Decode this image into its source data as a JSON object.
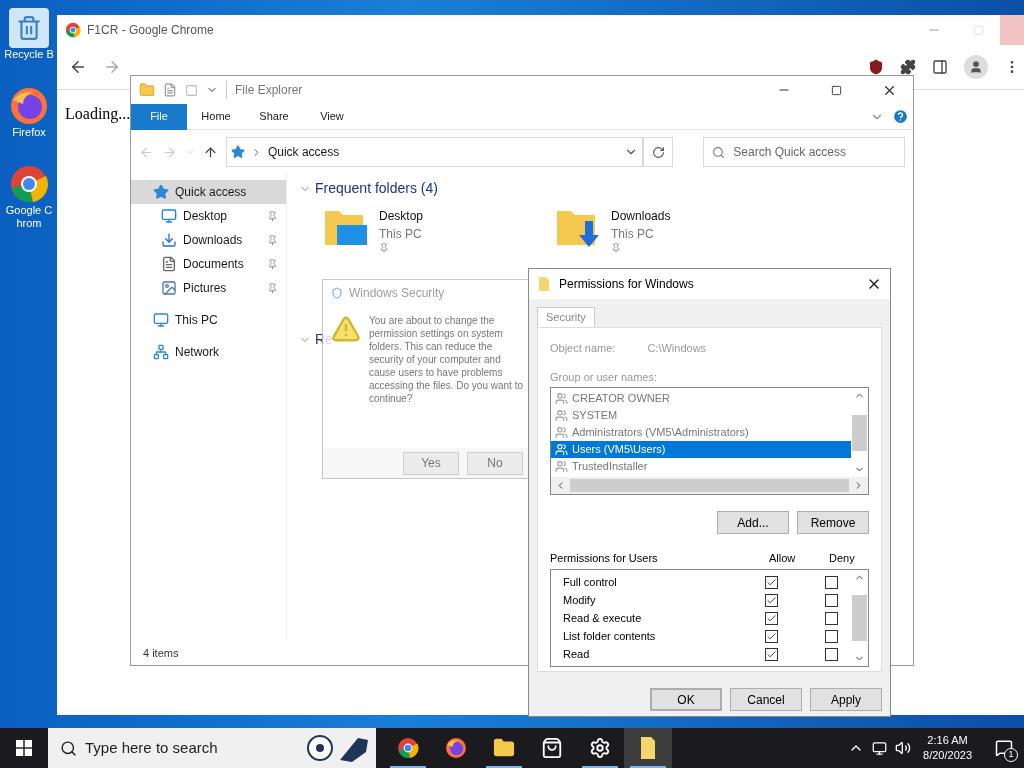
{
  "desktop_icons": [
    {
      "label": "Recycle B",
      "kind": "recycle"
    },
    {
      "label": "Firefox",
      "kind": "firefox"
    },
    {
      "label": "Google Chrom",
      "kind": "chrome"
    }
  ],
  "browser": {
    "title": "F1CR - Google Chrome",
    "page_text": "Loading..."
  },
  "explorer": {
    "title": "File Explorer",
    "ribbon_tabs": [
      {
        "label": "File",
        "selected": true
      },
      {
        "label": "Home",
        "selected": false
      },
      {
        "label": "Share",
        "selected": false
      },
      {
        "label": "View",
        "selected": false
      }
    ],
    "address": "Quick access",
    "search": {
      "placeholder": "Search Quick access"
    },
    "nav": [
      {
        "label": "Quick access",
        "kind": "star",
        "selected": true,
        "children": [
          {
            "label": "Desktop",
            "kind": "desktop",
            "pinned": true,
            "selected": false
          },
          {
            "label": "Downloads",
            "kind": "download",
            "pinned": true,
            "selected": false
          },
          {
            "label": "Documents",
            "kind": "document",
            "pinned": true,
            "selected": false
          },
          {
            "label": "Pictures",
            "kind": "picture",
            "pinned": true,
            "selected": false
          }
        ]
      },
      {
        "label": "This PC",
        "kind": "pc",
        "selected": false
      },
      {
        "label": "Network",
        "kind": "network",
        "selected": false
      }
    ],
    "sections": [
      {
        "title": "Frequent folders (4)",
        "items": [
          {
            "name": "Desktop",
            "location": "This PC",
            "kind": "desktop"
          },
          {
            "name": "Downloads",
            "location": "This PC",
            "kind": "download"
          }
        ]
      },
      {
        "title": "Re"
      }
    ],
    "status": "4 items"
  },
  "security_dialog": {
    "title": "Windows Security",
    "message": "You are about to change the permission settings on system folders. This can reduce the security of your computer and cause users to have problems accessing the files. Do you want to continue?",
    "buttons": [
      "Yes",
      "No"
    ]
  },
  "permissions": {
    "title": "Permissions for Windows",
    "tab": "Security",
    "object_label": "Object name:",
    "object_value": "C:\\Windows",
    "group_label": "Group or user names:",
    "users": [
      {
        "name": "CREATOR OWNER",
        "selected": false
      },
      {
        "name": "SYSTEM",
        "selected": false
      },
      {
        "name": "Administrators (VM5\\Administrators)",
        "selected": false
      },
      {
        "name": "Users (VM5\\Users)",
        "selected": true
      },
      {
        "name": "TrustedInstaller",
        "selected": false
      }
    ],
    "add": "Add...",
    "remove": "Remove",
    "perm_label": "Permissions for Users",
    "allow": "Allow",
    "deny": "Deny",
    "perms": [
      {
        "name": "Full control",
        "allow": true,
        "deny": false
      },
      {
        "name": "Modify",
        "allow": true,
        "deny": false
      },
      {
        "name": "Read & execute",
        "allow": true,
        "deny": false
      },
      {
        "name": "List folder contents",
        "allow": true,
        "deny": false
      },
      {
        "name": "Read",
        "allow": true,
        "deny": false
      }
    ],
    "buttons": [
      "OK",
      "Cancel",
      "Apply"
    ]
  },
  "taskbar": {
    "search": {
      "placeholder": "Type here to search"
    },
    "apps": [
      {
        "kind": "chrome",
        "active": true
      },
      {
        "kind": "firefox",
        "active": false
      },
      {
        "kind": "explorer",
        "active": true
      },
      {
        "kind": "store",
        "active": false
      },
      {
        "kind": "settings",
        "active": true
      },
      {
        "kind": "folder",
        "active": true
      }
    ],
    "time": "2:16 AM",
    "date": "8/20/2023",
    "notifications": "1"
  }
}
